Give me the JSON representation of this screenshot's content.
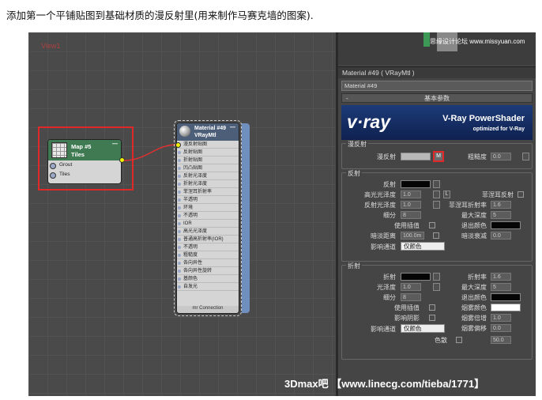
{
  "caption": "添加第一个平铺贴图到基础材质的漫反射里(用来制作马赛克墙的图案).",
  "editor": {
    "view_label": "View1"
  },
  "map_node": {
    "title": "Map #5",
    "subtitle": "Tiles",
    "ports": [
      "Grout",
      "Tiles"
    ],
    "collapse": "—"
  },
  "mat_node": {
    "title": "Material #49",
    "subtitle": "VRayMtl",
    "collapse": "—",
    "slots": [
      "漫反射贴图",
      "反射贴图",
      "折射贴图",
      "凹凸贴图",
      "反射光泽度",
      "折射光泽度",
      "菲涅耳折射率",
      "半透明",
      "环境",
      "不透明",
      "IOR",
      "高光光泽度",
      "普通高折射率(IOR)",
      "不透明",
      "粗糙度",
      "各向异性",
      "各向异性旋转",
      "基颜色",
      "自发光"
    ],
    "footer": "mr Connection"
  },
  "viewport": {
    "watermark": "思缘设计论坛 www.missyuan.com"
  },
  "panel": {
    "title": "Material #49  ( VRayMtl )",
    "name": "Material #49",
    "rollout": "基本参数",
    "rollout_mark": "-",
    "banner": {
      "logo": "v·ray",
      "title": "V-Ray PowerShader",
      "subtitle": "optimized for V-Ray"
    },
    "diffuse": {
      "group": "漫反射",
      "label": "漫反射",
      "map_btn": "M",
      "rough_label": "粗糙度",
      "rough": "0.0"
    },
    "reflection": {
      "group": "反射",
      "refl": "反射",
      "hilight": "高光光泽度",
      "hilight_val": "1.0",
      "gloss": "反射光泽度",
      "gloss_val": "1.0",
      "subdiv": "细分",
      "subdiv_val": "8",
      "interp": "使用插值",
      "dimdist": "暗淡距离",
      "dimdist_val": "100.0m",
      "affect": "影响通道",
      "affect_val": "仅颜色",
      "L": "L",
      "fresnel": "菲涅耳反射",
      "fresnel_ior": "菲涅耳折射率",
      "fresnel_ior_val": "1.6",
      "maxdepth": "最大深度",
      "maxdepth_val": "5",
      "exitcolor": "退出颜色",
      "dimfall": "暗淡衰减",
      "dimfall_val": "0.0"
    },
    "refraction": {
      "group": "折射",
      "refr": "折射",
      "gloss": "光泽度",
      "gloss_val": "1.0",
      "subdiv": "细分",
      "subdiv_val": "8",
      "interp": "使用插值",
      "shadows": "影响阴影",
      "affect": "影响通道",
      "affect_val": "仅颜色",
      "disp": "色散",
      "ior": "折射率",
      "ior_val": "1.6",
      "maxdepth": "最大深度",
      "maxdepth_val": "5",
      "exitcolor": "退出颜色",
      "fogcolor": "烟雾颜色",
      "fogmult": "烟雾倍增",
      "fogmult_val": "1.0",
      "fogbias": "烟雾偏移",
      "fogbias_val": "0.0",
      "abbe": "50.0"
    }
  },
  "bottom_watermark": "3Dmax吧 【www.linecg.com/tieba/1771】"
}
